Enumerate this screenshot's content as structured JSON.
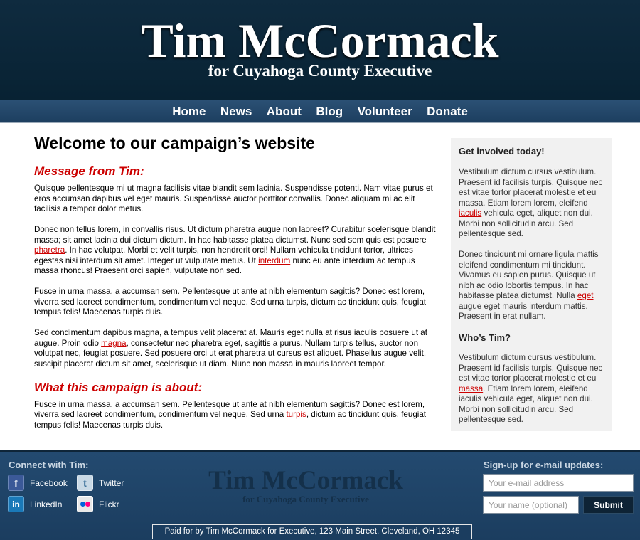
{
  "header": {
    "title": "Tim McCormack",
    "subtitle": "for Cuyahoga County Executive"
  },
  "nav": {
    "items": [
      "Home",
      "News",
      "About",
      "Blog",
      "Volunteer",
      "Donate"
    ]
  },
  "main": {
    "heading": "Welcome to our campaign’s website",
    "section1_title": "Message from Tim:",
    "p1": "Quisque pellentesque mi ut magna facilisis vitae blandit sem lacinia. Suspendisse potenti. Nam vitae purus et eros accumsan dapibus vel eget mauris. Suspendisse auctor porttitor convallis. Donec aliquam mi ac elit facilisis a tempor dolor metus.",
    "p2_a": "Donec non tellus lorem, in convallis risus. Ut dictum pharetra augue non laoreet? Curabitur scelerisque blandit massa; sit amet lacinia dui dictum dictum. In hac habitasse platea dictumst. Nunc sed sem quis est posuere ",
    "p2_link1": "pharetra",
    "p2_b": ". In hac volutpat. Morbi et velit turpis, non hendrerit orci! Nullam vehicula tincidunt tortor, ultrices egestas nisi interdum sit amet. Integer ut vulputate metus. Ut ",
    "p2_link2": "interdum",
    "p2_c": " nunc eu ante interdum ac tempus massa rhoncus! Praesent orci sapien, vulputate non sed.",
    "p3": "Fusce in urna massa, a accumsan sem. Pellentesque ut ante at nibh elementum sagittis? Donec est lorem, viverra sed laoreet condimentum, condimentum vel neque. Sed urna turpis, dictum ac tincidunt quis, feugiat tempus felis! Maecenas turpis duis.",
    "p4_a": "Sed condimentum dapibus magna, a tempus velit placerat at. Mauris eget nulla at risus iaculis posuere ut at augue. Proin odio ",
    "p4_link": "magna",
    "p4_b": ", consectetur nec pharetra eget, sagittis a purus. Nullam turpis tellus, auctor non volutpat nec, feugiat posuere. Sed posuere orci ut erat pharetra ut cursus est aliquet. Phasellus augue velit, suscipit placerat dictum sit amet, scelerisque ut diam. Nunc non massa in mauris laoreet tempor.",
    "section2_title": "What this campaign is about:",
    "p5_a": "Fusce in urna massa, a accumsan sem. Pellentesque ut ante at nibh elementum sagittis? Donec est lorem, viverra sed laoreet condimentum, condimentum vel neque. Sed urna ",
    "p5_link": "turpis",
    "p5_b": ", dictum ac tincidunt quis, feugiat tempus felis! Maecenas turpis duis."
  },
  "sidebar": {
    "title1": "Get involved today!",
    "s1_a": "Vestibulum dictum cursus vestibulum. Praesent id facilisis turpis. Quisque nec est vitae tortor placerat molestie et eu massa. Etiam lorem lorem, eleifend ",
    "s1_link": "iaculis",
    "s1_b": " vehicula eget, aliquet non dui. Morbi non sollicitudin arcu. Sed pellentesque sed.",
    "s2_a": "Donec tincidunt mi ornare ligula mattis eleifend condimentum mi tincidunt. Vivamus eu sapien purus. Quisque ut nibh ac odio lobortis tempus. In hac habitasse platea dictumst. Nulla ",
    "s2_link": "eget",
    "s2_b": " augue eget mauris interdum mattis. Praesent in erat nullam.",
    "title2": "Who’s Tim?",
    "s3_a": "Vestibulum dictum cursus vestibulum. Praesent id facilisis turpis. Quisque nec est vitae tortor placerat molestie et eu ",
    "s3_link": "massa",
    "s3_b": ". Etiam lorem lorem, eleifend iaculis vehicula eget, aliquet non dui. Morbi non sollicitudin arcu. Sed pellentesque sed."
  },
  "footer": {
    "connect_title": "Connect with Tim:",
    "social": {
      "facebook": "Facebook",
      "twitter": "Twitter",
      "linkedin": "LinkedIn",
      "flickr": "Flickr"
    },
    "logo_title": "Tim McCormack",
    "logo_subtitle": "for Cuyahoga County Executive",
    "signup_title": "Sign-up for e-mail updates:",
    "email_placeholder": "Your e-mail address",
    "name_placeholder": "Your name (optional)",
    "submit_label": "Submit",
    "paid_for": "Paid for by Tim McCormack for Executive, 123 Main Street, Cleveland, OH 12345"
  },
  "colors": {
    "header_bg": "#0f2b3f",
    "nav_bg": "#2b5074",
    "accent_red": "#cc0000",
    "footer_bg": "#234a70",
    "sidebar_bg": "#f1f1f1"
  }
}
